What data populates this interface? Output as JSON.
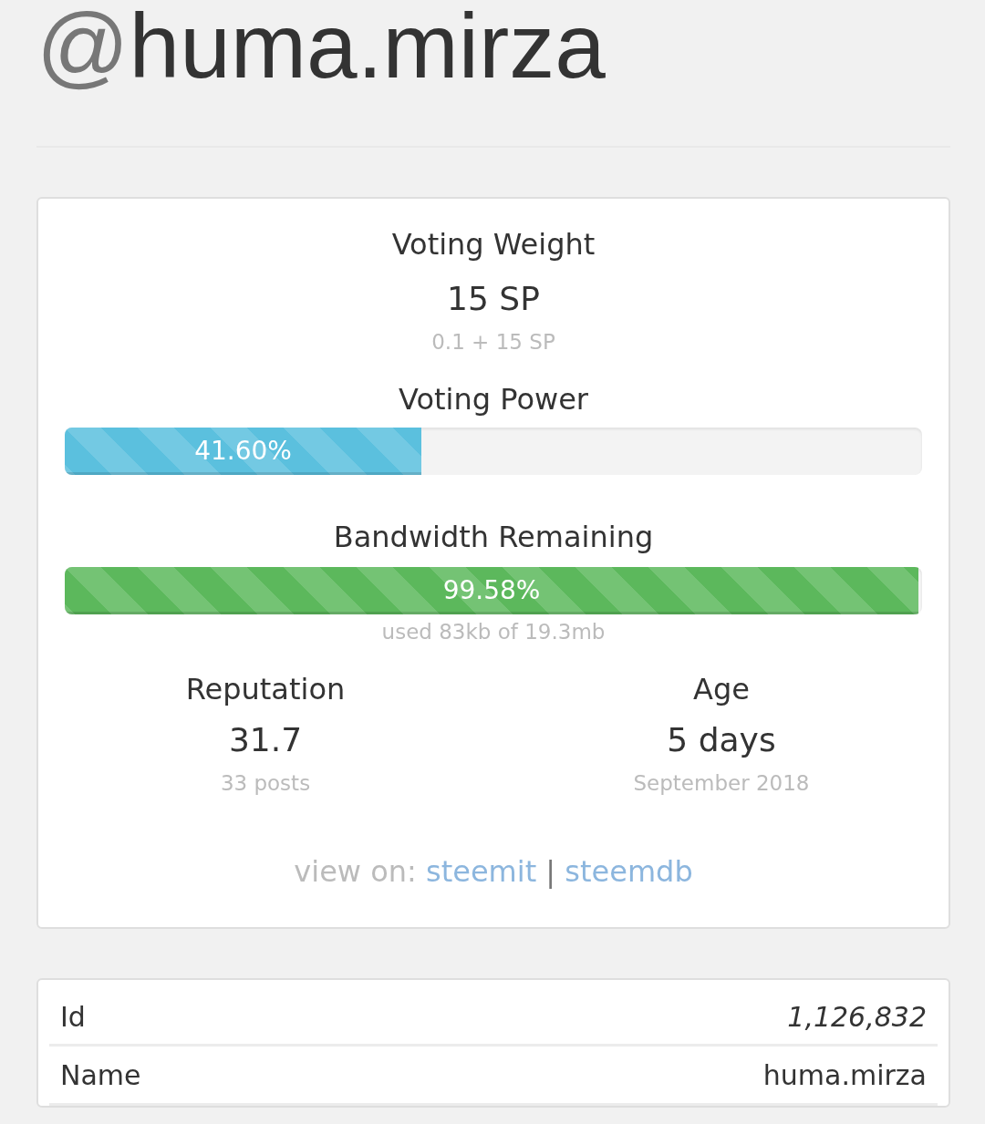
{
  "header": {
    "prefix": "@",
    "username": "huma.mirza"
  },
  "stats_card": {
    "voting_weight": {
      "label": "Voting Weight",
      "value": "15 SP",
      "detail": "0.1 + 15 SP"
    },
    "bars": [
      {
        "label": "Voting Power",
        "level": 0.416,
        "reading": "41.60%",
        "color": "#5bc0de"
      },
      {
        "label": "Bandwidth Remaining",
        "level": 0.9958,
        "reading": "99.58%",
        "color": "#5cb85c",
        "detail": "used 83kb of 19.3mb"
      }
    ],
    "stats": [
      {
        "label": "Reputation",
        "value": "31.7",
        "detail": "33 posts"
      },
      {
        "label": "Age",
        "value": "5 days",
        "detail": "September 2018"
      }
    ],
    "view_on": {
      "label": "view on:",
      "links": [
        "steemit",
        "steemdb"
      ],
      "separator": "|"
    }
  },
  "info_table": {
    "rows": [
      {
        "label": "Id",
        "value": "1,126,832",
        "kind": "number"
      },
      {
        "label": "Name",
        "value": "huma.mirza",
        "kind": "text"
      }
    ]
  }
}
